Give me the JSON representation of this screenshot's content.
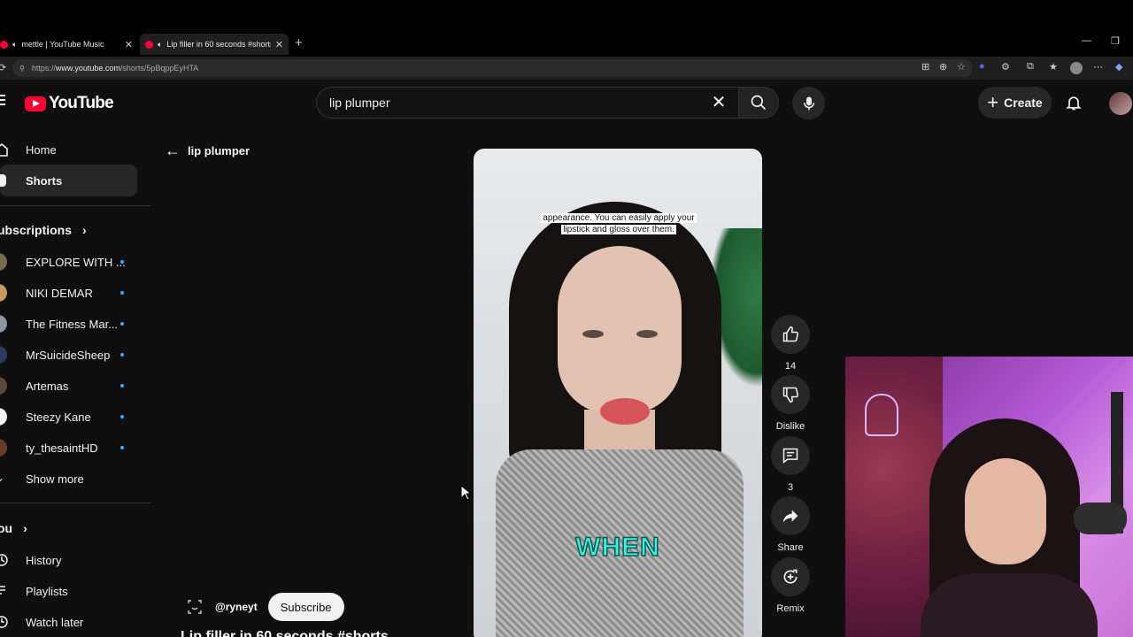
{
  "browser": {
    "tabs": [
      {
        "title": "mettle | YouTube Music"
      },
      {
        "title": "Lip filler in 60 seconds #shorts"
      }
    ],
    "url_prefix": "https://",
    "url_host": "www.youtube.com",
    "url_path": "/shorts/5pBqppEyHTA"
  },
  "header": {
    "logo_text": "YouTube",
    "search_value": "lip plumper",
    "create_label": "Create"
  },
  "sidebar": {
    "home": "Home",
    "shorts": "Shorts",
    "subscriptions_title": "ubscriptions",
    "subscriptions": [
      {
        "name": "EXPLORE WITH ...",
        "color": "#7a6a50"
      },
      {
        "name": "NIKI DEMAR",
        "color": "#c89a60"
      },
      {
        "name": "The Fitness Mar...",
        "color": "#8a9aa0"
      },
      {
        "name": "MrSuicideSheep",
        "color": "#2a3a5a"
      },
      {
        "name": "Artemas",
        "color": "#5a4a3a"
      },
      {
        "name": "Steezy Kane",
        "color": "#f0f0f0"
      },
      {
        "name": "ty_thesaintHD",
        "color": "#6a3a2a"
      }
    ],
    "show_more": "Show more",
    "you_title": "ou",
    "you_items": [
      "History",
      "Playlists",
      "Watch later"
    ]
  },
  "main": {
    "back_label": "lip plumper",
    "caption_line1": "appearance. You can easily apply your",
    "caption_line2": "lipstick and gloss over them.",
    "overlay_word": "WHEN",
    "channel_handle": "@ryneyt",
    "subscribe_label": "Subscribe",
    "video_title": "Lip filler in 60 seconds #shorts"
  },
  "actions": {
    "like_count": "14",
    "dislike_label": "Dislike",
    "comment_count": "3",
    "share_label": "Share",
    "remix_label": "Remix"
  },
  "colors": {
    "background": "#0f0f0f",
    "brand_red": "#ff0033",
    "accent_blue": "#3ea6ff"
  }
}
